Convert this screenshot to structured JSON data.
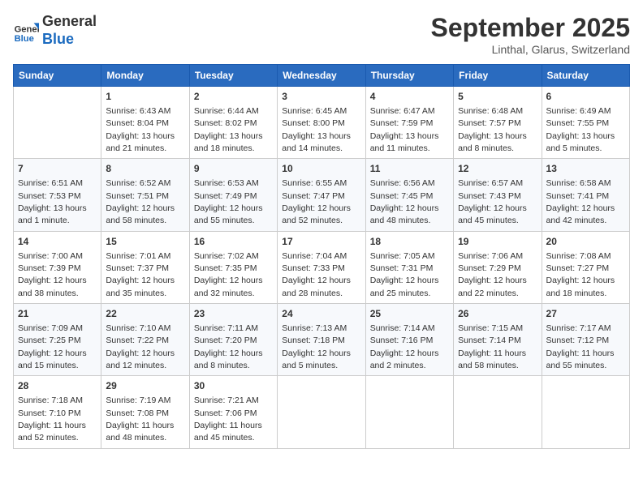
{
  "logo": {
    "line1": "General",
    "line2": "Blue"
  },
  "title": "September 2025",
  "subtitle": "Linthal, Glarus, Switzerland",
  "weekdays": [
    "Sunday",
    "Monday",
    "Tuesday",
    "Wednesday",
    "Thursday",
    "Friday",
    "Saturday"
  ],
  "weeks": [
    [
      {
        "day": "",
        "info": ""
      },
      {
        "day": "1",
        "info": "Sunrise: 6:43 AM\nSunset: 8:04 PM\nDaylight: 13 hours\nand 21 minutes."
      },
      {
        "day": "2",
        "info": "Sunrise: 6:44 AM\nSunset: 8:02 PM\nDaylight: 13 hours\nand 18 minutes."
      },
      {
        "day": "3",
        "info": "Sunrise: 6:45 AM\nSunset: 8:00 PM\nDaylight: 13 hours\nand 14 minutes."
      },
      {
        "day": "4",
        "info": "Sunrise: 6:47 AM\nSunset: 7:59 PM\nDaylight: 13 hours\nand 11 minutes."
      },
      {
        "day": "5",
        "info": "Sunrise: 6:48 AM\nSunset: 7:57 PM\nDaylight: 13 hours\nand 8 minutes."
      },
      {
        "day": "6",
        "info": "Sunrise: 6:49 AM\nSunset: 7:55 PM\nDaylight: 13 hours\nand 5 minutes."
      }
    ],
    [
      {
        "day": "7",
        "info": "Sunrise: 6:51 AM\nSunset: 7:53 PM\nDaylight: 13 hours\nand 1 minute."
      },
      {
        "day": "8",
        "info": "Sunrise: 6:52 AM\nSunset: 7:51 PM\nDaylight: 12 hours\nand 58 minutes."
      },
      {
        "day": "9",
        "info": "Sunrise: 6:53 AM\nSunset: 7:49 PM\nDaylight: 12 hours\nand 55 minutes."
      },
      {
        "day": "10",
        "info": "Sunrise: 6:55 AM\nSunset: 7:47 PM\nDaylight: 12 hours\nand 52 minutes."
      },
      {
        "day": "11",
        "info": "Sunrise: 6:56 AM\nSunset: 7:45 PM\nDaylight: 12 hours\nand 48 minutes."
      },
      {
        "day": "12",
        "info": "Sunrise: 6:57 AM\nSunset: 7:43 PM\nDaylight: 12 hours\nand 45 minutes."
      },
      {
        "day": "13",
        "info": "Sunrise: 6:58 AM\nSunset: 7:41 PM\nDaylight: 12 hours\nand 42 minutes."
      }
    ],
    [
      {
        "day": "14",
        "info": "Sunrise: 7:00 AM\nSunset: 7:39 PM\nDaylight: 12 hours\nand 38 minutes."
      },
      {
        "day": "15",
        "info": "Sunrise: 7:01 AM\nSunset: 7:37 PM\nDaylight: 12 hours\nand 35 minutes."
      },
      {
        "day": "16",
        "info": "Sunrise: 7:02 AM\nSunset: 7:35 PM\nDaylight: 12 hours\nand 32 minutes."
      },
      {
        "day": "17",
        "info": "Sunrise: 7:04 AM\nSunset: 7:33 PM\nDaylight: 12 hours\nand 28 minutes."
      },
      {
        "day": "18",
        "info": "Sunrise: 7:05 AM\nSunset: 7:31 PM\nDaylight: 12 hours\nand 25 minutes."
      },
      {
        "day": "19",
        "info": "Sunrise: 7:06 AM\nSunset: 7:29 PM\nDaylight: 12 hours\nand 22 minutes."
      },
      {
        "day": "20",
        "info": "Sunrise: 7:08 AM\nSunset: 7:27 PM\nDaylight: 12 hours\nand 18 minutes."
      }
    ],
    [
      {
        "day": "21",
        "info": "Sunrise: 7:09 AM\nSunset: 7:25 PM\nDaylight: 12 hours\nand 15 minutes."
      },
      {
        "day": "22",
        "info": "Sunrise: 7:10 AM\nSunset: 7:22 PM\nDaylight: 12 hours\nand 12 minutes."
      },
      {
        "day": "23",
        "info": "Sunrise: 7:11 AM\nSunset: 7:20 PM\nDaylight: 12 hours\nand 8 minutes."
      },
      {
        "day": "24",
        "info": "Sunrise: 7:13 AM\nSunset: 7:18 PM\nDaylight: 12 hours\nand 5 minutes."
      },
      {
        "day": "25",
        "info": "Sunrise: 7:14 AM\nSunset: 7:16 PM\nDaylight: 12 hours\nand 2 minutes."
      },
      {
        "day": "26",
        "info": "Sunrise: 7:15 AM\nSunset: 7:14 PM\nDaylight: 11 hours\nand 58 minutes."
      },
      {
        "day": "27",
        "info": "Sunrise: 7:17 AM\nSunset: 7:12 PM\nDaylight: 11 hours\nand 55 minutes."
      }
    ],
    [
      {
        "day": "28",
        "info": "Sunrise: 7:18 AM\nSunset: 7:10 PM\nDaylight: 11 hours\nand 52 minutes."
      },
      {
        "day": "29",
        "info": "Sunrise: 7:19 AM\nSunset: 7:08 PM\nDaylight: 11 hours\nand 48 minutes."
      },
      {
        "day": "30",
        "info": "Sunrise: 7:21 AM\nSunset: 7:06 PM\nDaylight: 11 hours\nand 45 minutes."
      },
      {
        "day": "",
        "info": ""
      },
      {
        "day": "",
        "info": ""
      },
      {
        "day": "",
        "info": ""
      },
      {
        "day": "",
        "info": ""
      }
    ]
  ]
}
